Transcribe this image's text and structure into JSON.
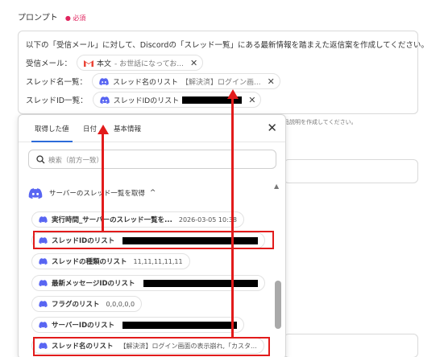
{
  "prompt": {
    "label": "プロンプト",
    "required": "● 必須",
    "text": "以下の「受信メール」に対して、Discordの「スレッド一覧」にある最新情報を踏まえた返信案を作成してください。",
    "rows": [
      {
        "label": "受信メール：",
        "chip_name": "本文",
        "chip_sub": "- お世話になってお..."
      },
      {
        "label": "スレッド名一覧：",
        "chip_name": "スレッド名のリスト",
        "chip_sub": "【解決済】ログイン画..."
      },
      {
        "label": "スレッドID一覧：",
        "chip_name": "スレッドIDのリスト",
        "chip_sub": ""
      }
    ]
  },
  "hint": "品説明を作成してください。",
  "panel": {
    "tabs": [
      "取得した値",
      "日付",
      "基本情報"
    ],
    "search_placeholder": "検索（前方一致）",
    "section": "サーバーのスレッド一覧を取得",
    "items": [
      {
        "name": "実行時間_サーバーのスレッド一覧を...",
        "value": "2026-03-05 10:38"
      },
      {
        "name": "スレッドIDのリスト",
        "value": ""
      },
      {
        "name": "スレッドの種類のリスト",
        "value": "11,11,11,11,11"
      },
      {
        "name": "最新メッセージIDのリスト",
        "value": ""
      },
      {
        "name": "フラグのリスト",
        "value": "0,0,0,0,0"
      },
      {
        "name": "サーバーIDのリスト",
        "value": ""
      },
      {
        "name": "スレッド名のリスト",
        "value": "【解決済】ログイン画面の表示崩れ,「カスタ..."
      }
    ]
  },
  "colors": {
    "discord": "#5865F2",
    "highlight": "#e21b1b",
    "tab_active": "#2d6bd9"
  }
}
